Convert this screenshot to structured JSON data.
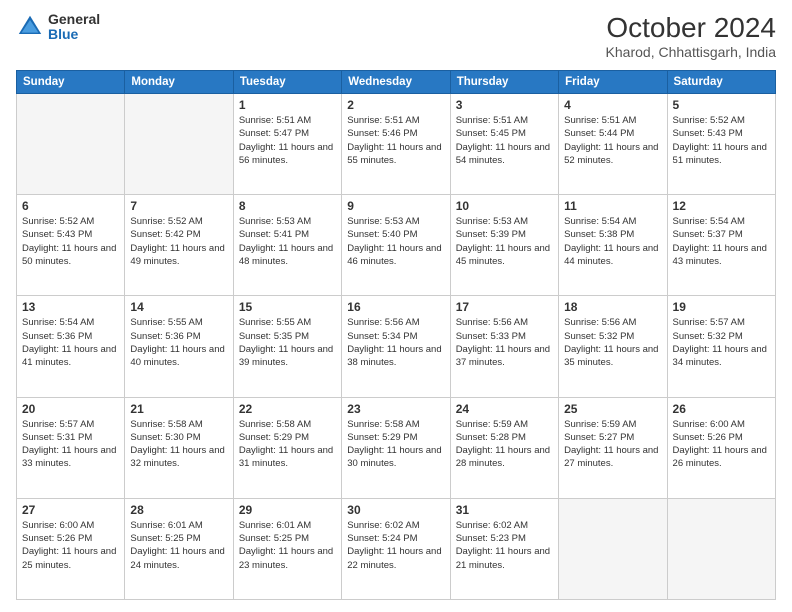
{
  "logo": {
    "general": "General",
    "blue": "Blue"
  },
  "title": "October 2024",
  "location": "Kharod, Chhattisgarh, India",
  "days_of_week": [
    "Sunday",
    "Monday",
    "Tuesday",
    "Wednesday",
    "Thursday",
    "Friday",
    "Saturday"
  ],
  "weeks": [
    [
      {
        "day": "",
        "info": ""
      },
      {
        "day": "",
        "info": ""
      },
      {
        "day": "1",
        "info": "Sunrise: 5:51 AM\nSunset: 5:47 PM\nDaylight: 11 hours and 56 minutes."
      },
      {
        "day": "2",
        "info": "Sunrise: 5:51 AM\nSunset: 5:46 PM\nDaylight: 11 hours and 55 minutes."
      },
      {
        "day": "3",
        "info": "Sunrise: 5:51 AM\nSunset: 5:45 PM\nDaylight: 11 hours and 54 minutes."
      },
      {
        "day": "4",
        "info": "Sunrise: 5:51 AM\nSunset: 5:44 PM\nDaylight: 11 hours and 52 minutes."
      },
      {
        "day": "5",
        "info": "Sunrise: 5:52 AM\nSunset: 5:43 PM\nDaylight: 11 hours and 51 minutes."
      }
    ],
    [
      {
        "day": "6",
        "info": "Sunrise: 5:52 AM\nSunset: 5:43 PM\nDaylight: 11 hours and 50 minutes."
      },
      {
        "day": "7",
        "info": "Sunrise: 5:52 AM\nSunset: 5:42 PM\nDaylight: 11 hours and 49 minutes."
      },
      {
        "day": "8",
        "info": "Sunrise: 5:53 AM\nSunset: 5:41 PM\nDaylight: 11 hours and 48 minutes."
      },
      {
        "day": "9",
        "info": "Sunrise: 5:53 AM\nSunset: 5:40 PM\nDaylight: 11 hours and 46 minutes."
      },
      {
        "day": "10",
        "info": "Sunrise: 5:53 AM\nSunset: 5:39 PM\nDaylight: 11 hours and 45 minutes."
      },
      {
        "day": "11",
        "info": "Sunrise: 5:54 AM\nSunset: 5:38 PM\nDaylight: 11 hours and 44 minutes."
      },
      {
        "day": "12",
        "info": "Sunrise: 5:54 AM\nSunset: 5:37 PM\nDaylight: 11 hours and 43 minutes."
      }
    ],
    [
      {
        "day": "13",
        "info": "Sunrise: 5:54 AM\nSunset: 5:36 PM\nDaylight: 11 hours and 41 minutes."
      },
      {
        "day": "14",
        "info": "Sunrise: 5:55 AM\nSunset: 5:36 PM\nDaylight: 11 hours and 40 minutes."
      },
      {
        "day": "15",
        "info": "Sunrise: 5:55 AM\nSunset: 5:35 PM\nDaylight: 11 hours and 39 minutes."
      },
      {
        "day": "16",
        "info": "Sunrise: 5:56 AM\nSunset: 5:34 PM\nDaylight: 11 hours and 38 minutes."
      },
      {
        "day": "17",
        "info": "Sunrise: 5:56 AM\nSunset: 5:33 PM\nDaylight: 11 hours and 37 minutes."
      },
      {
        "day": "18",
        "info": "Sunrise: 5:56 AM\nSunset: 5:32 PM\nDaylight: 11 hours and 35 minutes."
      },
      {
        "day": "19",
        "info": "Sunrise: 5:57 AM\nSunset: 5:32 PM\nDaylight: 11 hours and 34 minutes."
      }
    ],
    [
      {
        "day": "20",
        "info": "Sunrise: 5:57 AM\nSunset: 5:31 PM\nDaylight: 11 hours and 33 minutes."
      },
      {
        "day": "21",
        "info": "Sunrise: 5:58 AM\nSunset: 5:30 PM\nDaylight: 11 hours and 32 minutes."
      },
      {
        "day": "22",
        "info": "Sunrise: 5:58 AM\nSunset: 5:29 PM\nDaylight: 11 hours and 31 minutes."
      },
      {
        "day": "23",
        "info": "Sunrise: 5:58 AM\nSunset: 5:29 PM\nDaylight: 11 hours and 30 minutes."
      },
      {
        "day": "24",
        "info": "Sunrise: 5:59 AM\nSunset: 5:28 PM\nDaylight: 11 hours and 28 minutes."
      },
      {
        "day": "25",
        "info": "Sunrise: 5:59 AM\nSunset: 5:27 PM\nDaylight: 11 hours and 27 minutes."
      },
      {
        "day": "26",
        "info": "Sunrise: 6:00 AM\nSunset: 5:26 PM\nDaylight: 11 hours and 26 minutes."
      }
    ],
    [
      {
        "day": "27",
        "info": "Sunrise: 6:00 AM\nSunset: 5:26 PM\nDaylight: 11 hours and 25 minutes."
      },
      {
        "day": "28",
        "info": "Sunrise: 6:01 AM\nSunset: 5:25 PM\nDaylight: 11 hours and 24 minutes."
      },
      {
        "day": "29",
        "info": "Sunrise: 6:01 AM\nSunset: 5:25 PM\nDaylight: 11 hours and 23 minutes."
      },
      {
        "day": "30",
        "info": "Sunrise: 6:02 AM\nSunset: 5:24 PM\nDaylight: 11 hours and 22 minutes."
      },
      {
        "day": "31",
        "info": "Sunrise: 6:02 AM\nSunset: 5:23 PM\nDaylight: 11 hours and 21 minutes."
      },
      {
        "day": "",
        "info": ""
      },
      {
        "day": "",
        "info": ""
      }
    ]
  ]
}
